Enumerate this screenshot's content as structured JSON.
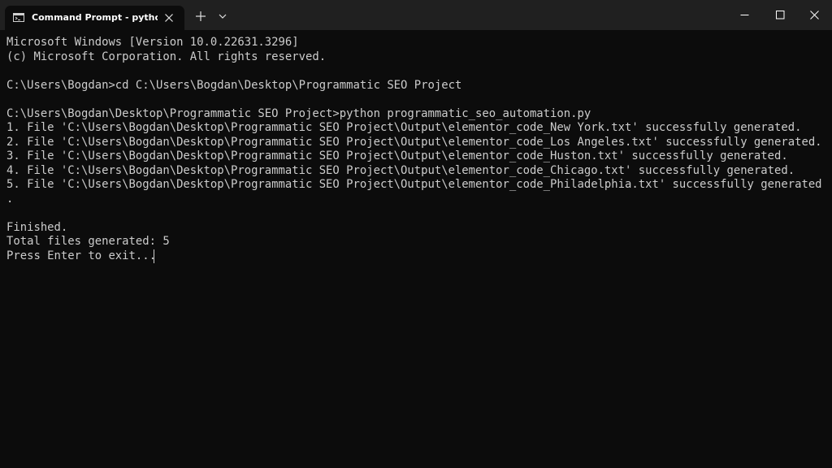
{
  "window": {
    "tab_title": "Command Prompt - python p"
  },
  "console": {
    "lines": [
      "Microsoft Windows [Version 10.0.22631.3296]",
      "(c) Microsoft Corporation. All rights reserved.",
      "",
      "C:\\Users\\Bogdan>cd C:\\Users\\Bogdan\\Desktop\\Programmatic SEO Project",
      "",
      "C:\\Users\\Bogdan\\Desktop\\Programmatic SEO Project>python programmatic_seo_automation.py",
      "1. File 'C:\\Users\\Bogdan\\Desktop\\Programmatic SEO Project\\Output\\elementor_code_New York.txt' successfully generated.",
      "2. File 'C:\\Users\\Bogdan\\Desktop\\Programmatic SEO Project\\Output\\elementor_code_Los Angeles.txt' successfully generated.",
      "3. File 'C:\\Users\\Bogdan\\Desktop\\Programmatic SEO Project\\Output\\elementor_code_Huston.txt' successfully generated.",
      "4. File 'C:\\Users\\Bogdan\\Desktop\\Programmatic SEO Project\\Output\\elementor_code_Chicago.txt' successfully generated.",
      "5. File 'C:\\Users\\Bogdan\\Desktop\\Programmatic SEO Project\\Output\\elementor_code_Philadelphia.txt' successfully generated",
      ".",
      "",
      "Finished.",
      "Total files generated: 5",
      "Press Enter to exit..."
    ]
  },
  "colors": {
    "console_bg": "#0c0c0c",
    "console_text": "#cccccc",
    "titlebar_bg": "#202020",
    "tab_bg": "#0c0c0c"
  },
  "icons": {
    "tab_icon": "cmd-icon",
    "tab_close": "close-icon",
    "new_tab": "plus-icon",
    "dropdown": "chevron-down-icon",
    "minimize": "minimize-icon",
    "maximize": "maximize-icon",
    "close": "close-icon"
  }
}
